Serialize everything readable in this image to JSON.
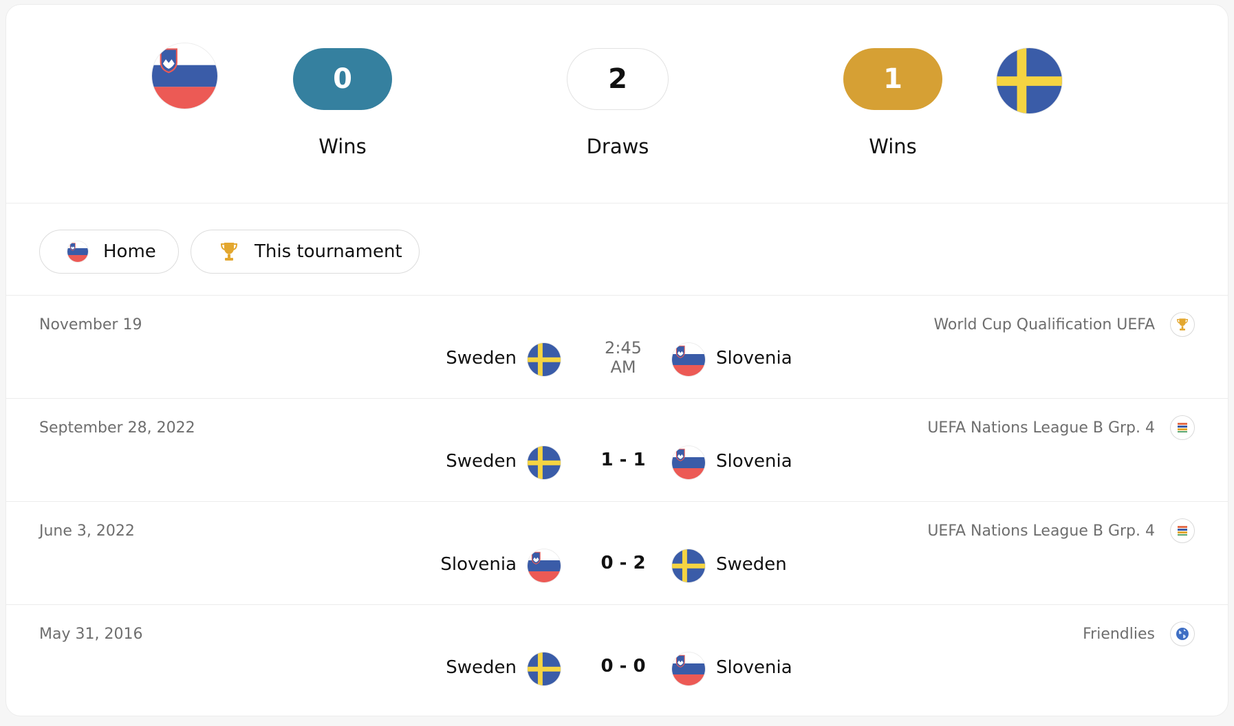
{
  "summary": {
    "home_team": "Slovenia",
    "away_team": "Sweden",
    "home_wins": "0",
    "draws": "2",
    "away_wins": "1",
    "home_wins_label": "Wins",
    "draws_label": "Draws",
    "away_wins_label": "Wins",
    "colors": {
      "home": "#35809f",
      "away": "#d6a034"
    }
  },
  "filters": {
    "home_label": "Home",
    "tournament_label": "This tournament"
  },
  "matches": [
    {
      "date": "November 19",
      "competition": "World Cup Qualification UEFA",
      "comp_icon": "trophy-icon",
      "home": "Sweden",
      "home_flag": "sweden",
      "score": "2:45 AM",
      "away": "Slovenia",
      "away_flag": "slovenia"
    },
    {
      "date": "September 28, 2022",
      "competition": "UEFA Nations League B Grp. 4",
      "comp_icon": "nations-league-icon",
      "home": "Sweden",
      "home_flag": "sweden",
      "score": "1 - 1",
      "away": "Slovenia",
      "away_flag": "slovenia"
    },
    {
      "date": "June 3, 2022",
      "competition": "UEFA Nations League B Grp. 4",
      "comp_icon": "nations-league-icon",
      "home": "Slovenia",
      "home_flag": "slovenia",
      "score": "0 - 2",
      "away": "Sweden",
      "away_flag": "sweden"
    },
    {
      "date": "May 31, 2016",
      "competition": "Friendlies",
      "comp_icon": "globe-icon",
      "home": "Sweden",
      "home_flag": "sweden",
      "score": "0 - 0",
      "away": "Slovenia",
      "away_flag": "slovenia"
    }
  ]
}
